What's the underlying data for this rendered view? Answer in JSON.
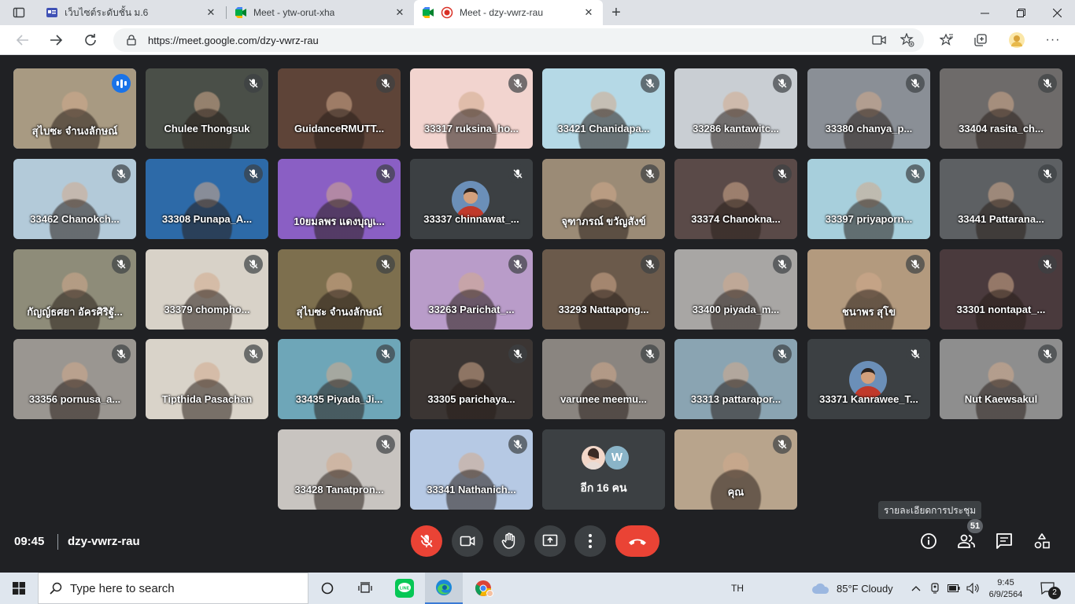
{
  "browser": {
    "tabs": [
      {
        "title": "เว็บไซต์ระดับชั้น ม.6",
        "active": false
      },
      {
        "title": "Meet - ytw-orut-xha",
        "active": false
      },
      {
        "title": "Meet - dzy-vwrz-rau",
        "active": true
      }
    ],
    "url": "https://meet.google.com/dzy-vwrz-rau"
  },
  "meeting": {
    "time": "09:45",
    "code": "dzy-vwrz-rau",
    "participant_count": "51",
    "tooltip": "รายละเอียดการประชุม",
    "others_label": "อีก 16 คน",
    "others_avatar_letter": "W",
    "participants": [
      {
        "name": "สุไบซะ จำนงลักษณ์",
        "bg": "#a89a82",
        "speaking": true
      },
      {
        "name": "Chulee Thongsuk",
        "bg": "#4a4f48"
      },
      {
        "name": "GuidanceRMUTT...",
        "bg": "#5e4438"
      },
      {
        "name": "33317 ruksina_ho...",
        "bg": "#f2d4cf"
      },
      {
        "name": "33421 Chanidapa...",
        "bg": "#b5d9e6"
      },
      {
        "name": "33286 kantawitc...",
        "bg": "#c9ced3"
      },
      {
        "name": "33380 chanya_p...",
        "bg": "#8a8f96"
      },
      {
        "name": "33404 rasita_ch...",
        "bg": "#6e6b6a"
      },
      {
        "name": "33462 Chanokch...",
        "bg": "#b3cad9"
      },
      {
        "name": "33308 Punapa_A...",
        "bg": "#2d6aa8"
      },
      {
        "name": "10ยมลพร แดงบุญเ...",
        "bg": "#8a5fc4"
      },
      {
        "name": "33337 chinnawat_...",
        "bg": "#3c4043",
        "avatar": true
      },
      {
        "name": "จุฑาภรณ์ ขวัญสังข์",
        "bg": "#9b8b76"
      },
      {
        "name": "33374 Chanokna...",
        "bg": "#5a4a48"
      },
      {
        "name": "33397 priyaporn...",
        "bg": "#a7cfdc"
      },
      {
        "name": "33441 Pattarana...",
        "bg": "#5d6063"
      },
      {
        "name": "กัญญ์ธศยา อัครศิริฐั...",
        "bg": "#8e8c79"
      },
      {
        "name": "33379 chompho...",
        "bg": "#d8d2c8"
      },
      {
        "name": "สุไบซะ จำนงลักษณ์",
        "bg": "#7d6f4e"
      },
      {
        "name": "33263 Parichat_...",
        "bg": "#b99cc9"
      },
      {
        "name": "33293 Nattapong...",
        "bg": "#6b5a4b"
      },
      {
        "name": "33400 piyada_m...",
        "bg": "#a8a6a4"
      },
      {
        "name": "ชนาพร สุโข",
        "bg": "#b39a7e"
      },
      {
        "name": "33301 nontapat_...",
        "bg": "#4a3a3d"
      },
      {
        "name": "33356 pornusa_a...",
        "bg": "#9a9691"
      },
      {
        "name": "Tipthida Pasachan",
        "bg": "#d9d3c9"
      },
      {
        "name": "33435 Piyada_Ji...",
        "bg": "#6ea6b8"
      },
      {
        "name": "33305 parichaya...",
        "bg": "#3b3533"
      },
      {
        "name": "varunee meemu...",
        "bg": "#8a8580"
      },
      {
        "name": "33313 pattarapor...",
        "bg": "#8aa4b2"
      },
      {
        "name": "33371 Kanrawee_T...",
        "bg": "#3c4043",
        "avatar": true
      },
      {
        "name": "Nut Kaewsakul",
        "bg": "#8e8e8e"
      },
      {
        "name": "33428 Tanatpron...",
        "bg": "#c8c4c0"
      },
      {
        "name": "33341 Nathanich...",
        "bg": "#b6c9e4"
      },
      {
        "name": "คุณ",
        "bg": "#b8a48c"
      }
    ]
  },
  "taskbar": {
    "search_placeholder": "Type here to search",
    "lang": "TH",
    "weather": "85°F  Cloudy",
    "time": "9:45",
    "date": "6/9/2564",
    "notifications": "2"
  },
  "colors": {
    "meet_bg": "#202124",
    "end_call": "#ea4335",
    "accent": "#1a73e8"
  }
}
